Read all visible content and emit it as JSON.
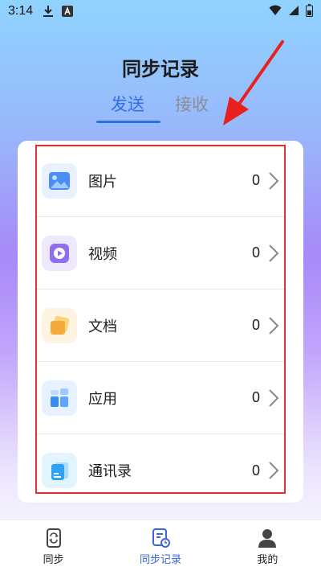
{
  "status_bar": {
    "time": "3:14",
    "icons": [
      "download-icon",
      "keyboard-a-icon"
    ],
    "right_icons": [
      "wifi-icon",
      "signal-icon",
      "battery-icon"
    ]
  },
  "header": {
    "title": "同步记录",
    "tabs": [
      {
        "label": "发送",
        "active": true
      },
      {
        "label": "接收",
        "active": false
      }
    ]
  },
  "list": {
    "items": [
      {
        "label": "图片",
        "count": "0",
        "icon": "image-icon"
      },
      {
        "label": "视频",
        "count": "0",
        "icon": "video-icon"
      },
      {
        "label": "文档",
        "count": "0",
        "icon": "document-icon"
      },
      {
        "label": "应用",
        "count": "0",
        "icon": "apps-icon"
      },
      {
        "label": "通讯录",
        "count": "0",
        "icon": "contacts-icon"
      }
    ]
  },
  "bottom_nav": {
    "items": [
      {
        "label": "同步",
        "icon": "phone-sync-icon",
        "active": false
      },
      {
        "label": "同步记录",
        "icon": "sync-record-icon",
        "active": true
      },
      {
        "label": "我的",
        "icon": "profile-icon",
        "active": false
      }
    ]
  },
  "colors": {
    "accent": "#2f6fe2",
    "highlight": "#e03030",
    "arrow": "#e82020"
  }
}
